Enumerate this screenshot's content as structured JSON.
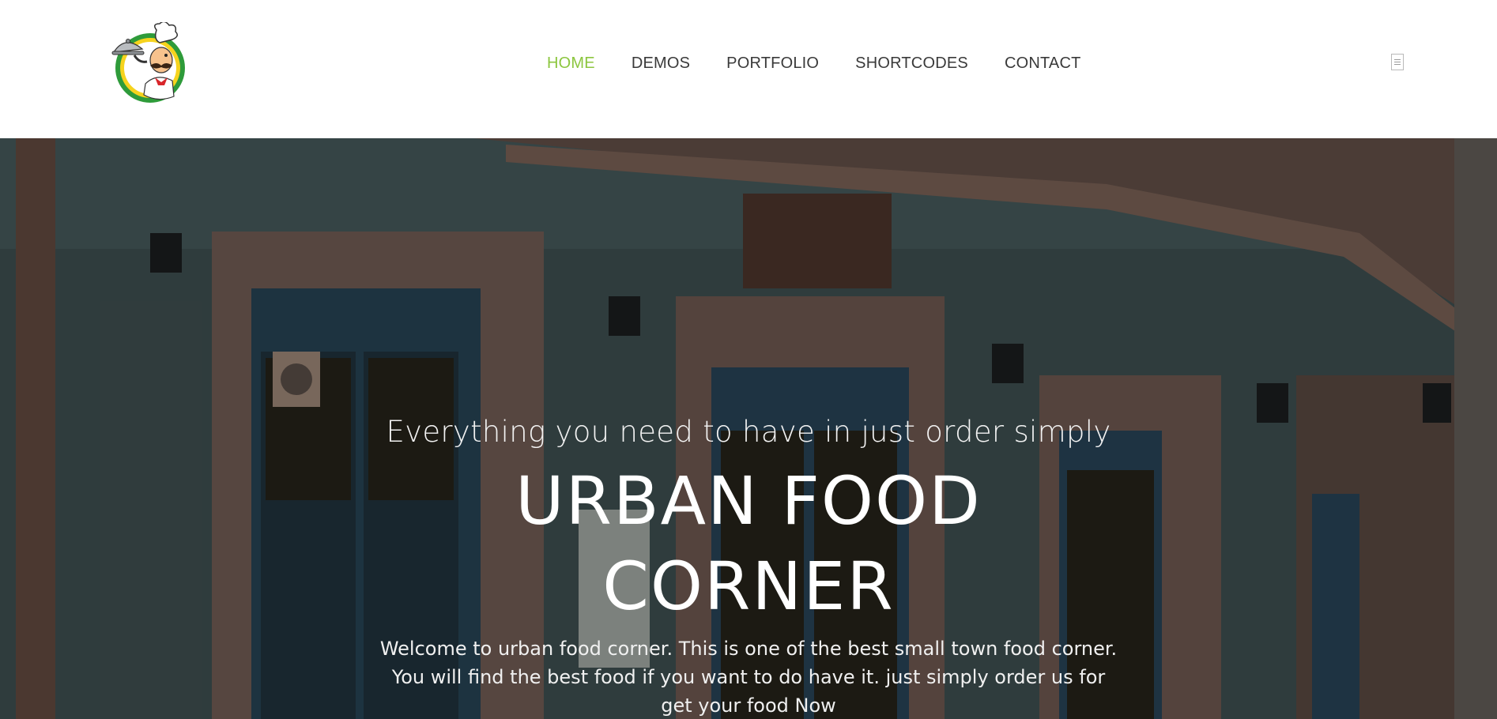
{
  "header": {
    "logo_alt": "Chef mascot logo",
    "nav": [
      {
        "label": "HOME",
        "active": true
      },
      {
        "label": "DEMOS",
        "active": false
      },
      {
        "label": "PORTFOLIO",
        "active": false
      },
      {
        "label": "SHORTCODES",
        "active": false
      },
      {
        "label": "CONTACT",
        "active": false
      }
    ],
    "menu_icon": "menu-icon"
  },
  "hero": {
    "subtitle": "Everything you need to have in just order simply",
    "title_line1": "URBAN FOOD",
    "title_line2": "CORNER",
    "description": "Welcome to urban food corner. This is one of the best small town food corner. You will find the best food if you want to do have it. just simply order us for get your food Now"
  },
  "colors": {
    "accent": "#8cc63f",
    "nav_text": "#3a3a3a",
    "hero_text": "#ffffff"
  }
}
